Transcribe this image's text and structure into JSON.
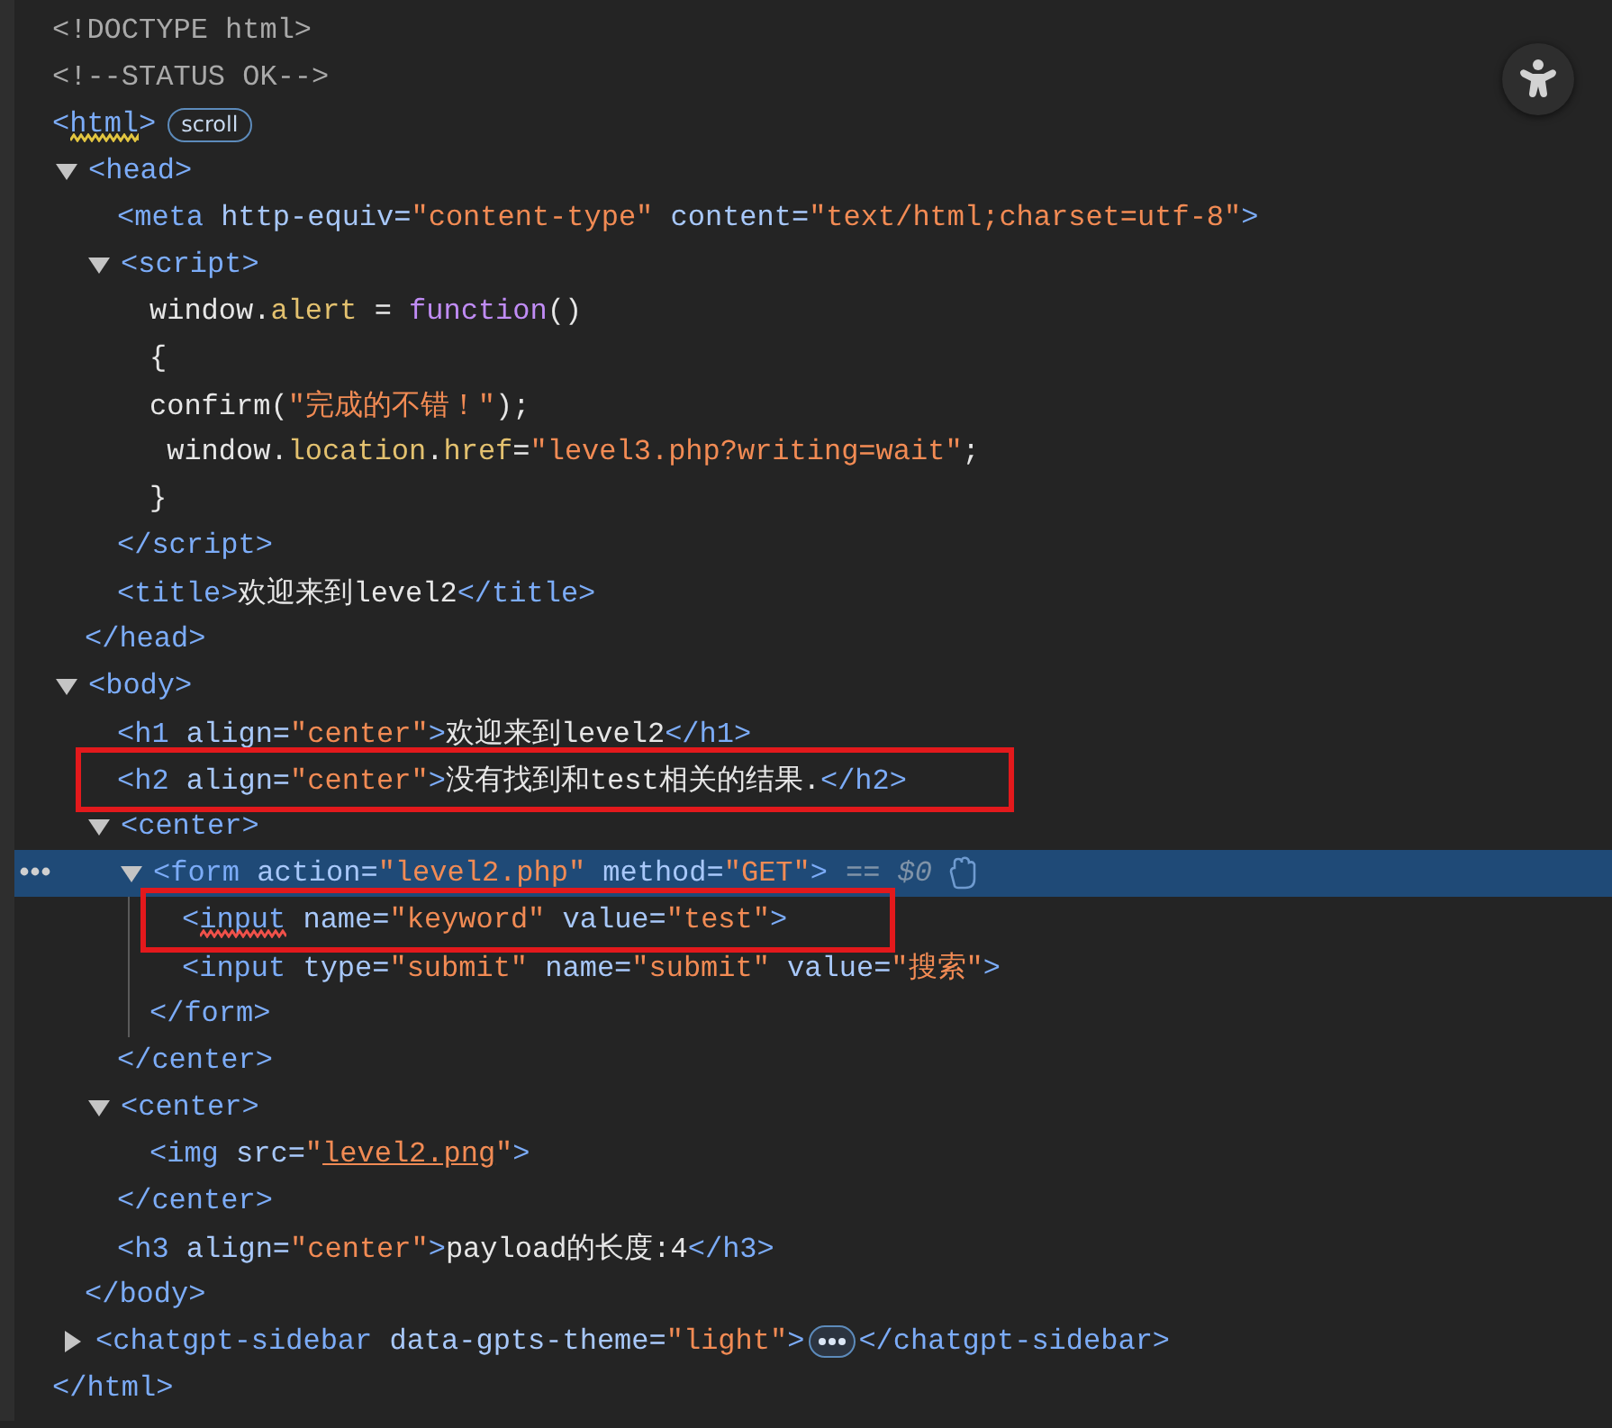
{
  "document": [
    {
      "selected": false,
      "boxed": false,
      "tokens": [
        {
          "kind": "comment",
          "text": "<!DOCTYPE html>"
        }
      ]
    },
    {
      "selected": false,
      "boxed": false,
      "tokens": [
        {
          "kind": "comment",
          "text": "<!--STATUS OK-->"
        }
      ]
    },
    {
      "selected": false,
      "boxed": false,
      "tokens": [
        {
          "kind": "tag",
          "text": "<"
        },
        {
          "kind": "tag",
          "text": "html",
          "issue": true,
          "color": "#e2c541"
        },
        {
          "kind": "tag",
          "text": ">"
        },
        {
          "kind": "badge",
          "text": "scroll"
        }
      ],
      "close": [
        {
          "kind": "tag",
          "text": "</html>"
        }
      ],
      "children": [
        {
          "selected": false,
          "boxed": false,
          "expanded": true,
          "tokens": [
            {
              "kind": "tag",
              "text": "<head>"
            }
          ],
          "close": [
            {
              "kind": "tag",
              "text": "</head>"
            }
          ],
          "children": [
            {
              "selected": false,
              "boxed": false,
              "tokens": [
                {
                  "kind": "tag",
                  "text": "<meta"
                },
                {
                  "kind": "attr",
                  "text": " http-equiv="
                },
                {
                  "kind": "value",
                  "text": "\"content-type\""
                },
                {
                  "kind": "attr",
                  "text": " content="
                },
                {
                  "kind": "value",
                  "text": "\"text/html;charset=utf-8\""
                },
                {
                  "kind": "tag",
                  "text": ">"
                }
              ]
            },
            {
              "selected": false,
              "boxed": false,
              "expanded": true,
              "tokens": [
                {
                  "kind": "tag",
                  "text": "<script>"
                }
              ],
              "close": [
                {
                  "kind": "tag",
                  "text": "</script>"
                }
              ],
              "children": [
                {
                  "selected": false,
                  "boxed": false,
                  "tokens": [
                    {
                      "kind": "ident",
                      "text": "window."
                    },
                    {
                      "kind": "prop",
                      "text": "alert"
                    },
                    {
                      "kind": "ident",
                      "text": " = "
                    },
                    {
                      "kind": "keyword",
                      "text": "function"
                    },
                    {
                      "kind": "ident",
                      "text": "()"
                    }
                  ]
                },
                {
                  "selected": false,
                  "boxed": false,
                  "tokens": [
                    {
                      "kind": "ident",
                      "text": "{"
                    }
                  ]
                },
                {
                  "selected": false,
                  "boxed": false,
                  "tokens": [
                    {
                      "kind": "ident",
                      "text": "confirm("
                    },
                    {
                      "kind": "string",
                      "text": "\"完成的不错！\""
                    },
                    {
                      "kind": "ident",
                      "text": ");"
                    }
                  ]
                },
                {
                  "selected": false,
                  "boxed": false,
                  "tokens": [
                    {
                      "kind": "ident",
                      "text": " window."
                    },
                    {
                      "kind": "prop",
                      "text": "location"
                    },
                    {
                      "kind": "ident",
                      "text": "."
                    },
                    {
                      "kind": "prop",
                      "text": "href"
                    },
                    {
                      "kind": "ident",
                      "text": "="
                    },
                    {
                      "kind": "string",
                      "text": "\"level3.php?writing=wait\""
                    },
                    {
                      "kind": "ident",
                      "text": ";"
                    }
                  ]
                },
                {
                  "selected": false,
                  "boxed": false,
                  "tokens": [
                    {
                      "kind": "ident",
                      "text": "}"
                    }
                  ]
                }
              ]
            },
            {
              "selected": false,
              "boxed": false,
              "tokens": [
                {
                  "kind": "tag",
                  "text": "<title>"
                },
                {
                  "kind": "text",
                  "text": "欢迎来到level2"
                },
                {
                  "kind": "tag",
                  "text": "</title>"
                }
              ]
            }
          ]
        },
        {
          "selected": false,
          "boxed": false,
          "expanded": true,
          "tokens": [
            {
              "kind": "tag",
              "text": "<body>"
            }
          ],
          "close": [
            {
              "kind": "tag",
              "text": "</body>"
            }
          ],
          "children": [
            {
              "selected": false,
              "boxed": false,
              "tokens": [
                {
                  "kind": "tag",
                  "text": "<h1"
                },
                {
                  "kind": "attr",
                  "text": " align="
                },
                {
                  "kind": "value",
                  "text": "\"center\""
                },
                {
                  "kind": "tag",
                  "text": ">"
                },
                {
                  "kind": "text",
                  "text": "欢迎来到level2"
                },
                {
                  "kind": "tag",
                  "text": "</h1>"
                }
              ]
            },
            {
              "selected": false,
              "boxed": true,
              "tokens": [
                {
                  "kind": "tag",
                  "text": "<h2"
                },
                {
                  "kind": "attr",
                  "text": " align="
                },
                {
                  "kind": "value",
                  "text": "\"center\""
                },
                {
                  "kind": "tag",
                  "text": ">"
                },
                {
                  "kind": "text",
                  "text": "没有找到和test相关的结果."
                },
                {
                  "kind": "tag",
                  "text": "</h2>"
                }
              ]
            },
            {
              "selected": false,
              "boxed": false,
              "expanded": true,
              "tokens": [
                {
                  "kind": "tag",
                  "text": "<center>"
                }
              ],
              "close": [
                {
                  "kind": "tag",
                  "text": "</center>"
                }
              ],
              "children": [
                {
                  "selected": true,
                  "boxed": false,
                  "expanded": true,
                  "suffix": "== $0",
                  "tokens": [
                    {
                      "kind": "tag",
                      "text": "<form"
                    },
                    {
                      "kind": "attr",
                      "text": " action="
                    },
                    {
                      "kind": "value",
                      "text": "\"level2.php\""
                    },
                    {
                      "kind": "attr",
                      "text": " method="
                    },
                    {
                      "kind": "value",
                      "text": "\"GET\""
                    },
                    {
                      "kind": "tag",
                      "text": ">"
                    }
                  ],
                  "close": [
                    {
                      "kind": "tag",
                      "text": "</form>"
                    }
                  ],
                  "children": [
                    {
                      "selected": false,
                      "boxed": true,
                      "tokens": [
                        {
                          "kind": "tag",
                          "text": "<"
                        },
                        {
                          "kind": "tag",
                          "text": "input",
                          "issue": true,
                          "color": "#f0514a"
                        },
                        {
                          "kind": "attr",
                          "text": " name="
                        },
                        {
                          "kind": "value",
                          "text": "\"keyword\""
                        },
                        {
                          "kind": "attr",
                          "text": " value="
                        },
                        {
                          "kind": "value",
                          "text": "\"test\""
                        },
                        {
                          "kind": "tag",
                          "text": ">"
                        }
                      ]
                    },
                    {
                      "selected": false,
                      "boxed": false,
                      "tokens": [
                        {
                          "kind": "tag",
                          "text": "<input"
                        },
                        {
                          "kind": "attr",
                          "text": " type="
                        },
                        {
                          "kind": "value",
                          "text": "\"submit\""
                        },
                        {
                          "kind": "attr",
                          "text": " name="
                        },
                        {
                          "kind": "value",
                          "text": "\"submit\""
                        },
                        {
                          "kind": "attr",
                          "text": " value="
                        },
                        {
                          "kind": "value",
                          "text": "\"搜索\""
                        },
                        {
                          "kind": "tag",
                          "text": ">"
                        }
                      ]
                    }
                  ]
                }
              ]
            },
            {
              "selected": false,
              "boxed": false,
              "expanded": true,
              "tokens": [
                {
                  "kind": "tag",
                  "text": "<center>"
                }
              ],
              "close": [
                {
                  "kind": "tag",
                  "text": "</center>"
                }
              ],
              "children": [
                {
                  "selected": false,
                  "boxed": false,
                  "tokens": [
                    {
                      "kind": "tag",
                      "text": "<img"
                    },
                    {
                      "kind": "attr",
                      "text": " src="
                    },
                    {
                      "kind": "value",
                      "text": "\""
                    },
                    {
                      "kind": "link",
                      "text": "level2.png"
                    },
                    {
                      "kind": "value",
                      "text": "\""
                    },
                    {
                      "kind": "tag",
                      "text": ">"
                    }
                  ]
                }
              ]
            },
            {
              "selected": false,
              "boxed": false,
              "tokens": [
                {
                  "kind": "tag",
                  "text": "<h3"
                },
                {
                  "kind": "attr",
                  "text": " align="
                },
                {
                  "kind": "value",
                  "text": "\"center\""
                },
                {
                  "kind": "tag",
                  "text": ">"
                },
                {
                  "kind": "text",
                  "text": "payload的长度:4"
                },
                {
                  "kind": "tag",
                  "text": "</h3>"
                }
              ]
            }
          ]
        },
        {
          "selected": false,
          "boxed": false,
          "expanded": false,
          "tokens": [
            {
              "kind": "tag",
              "text": "<chatgpt-sidebar"
            },
            {
              "kind": "attr",
              "text": " data-gpts-theme="
            },
            {
              "kind": "value",
              "text": "\"light\""
            },
            {
              "kind": "tag",
              "text": ">"
            },
            {
              "kind": "more"
            },
            {
              "kind": "tag",
              "text": "</chatgpt-sidebar>"
            }
          ]
        }
      ]
    }
  ]
}
